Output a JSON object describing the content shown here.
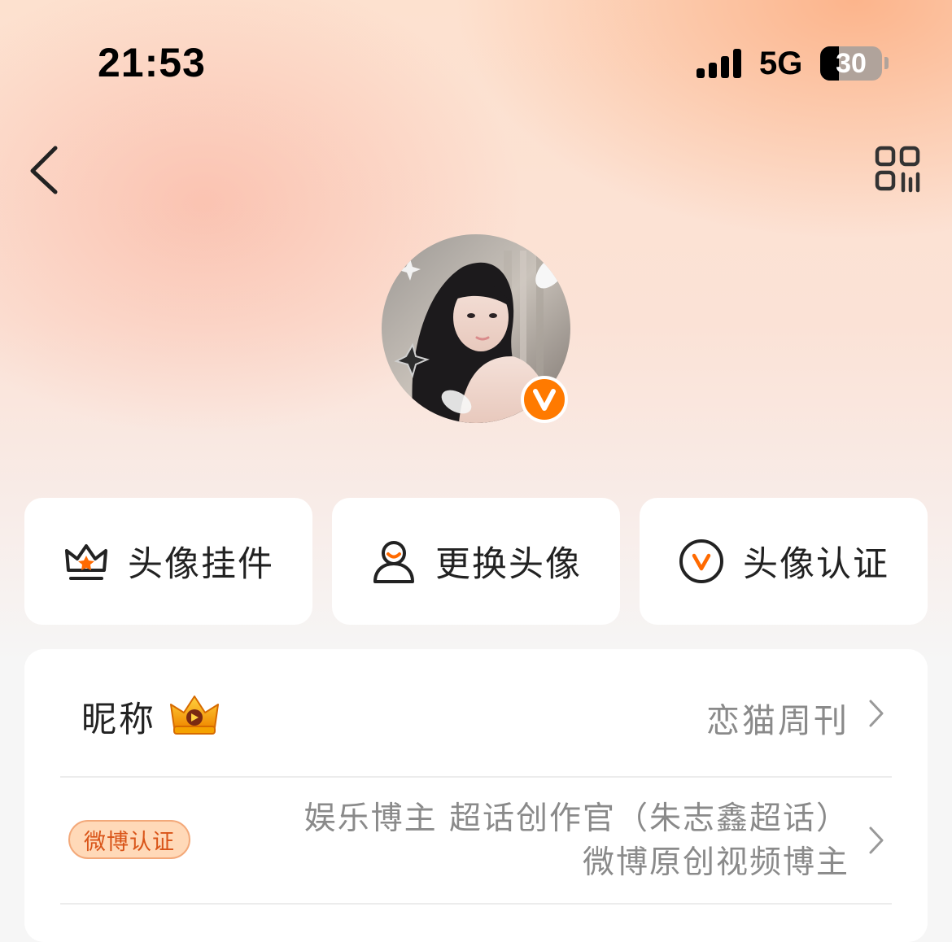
{
  "status_bar": {
    "time": "21:53",
    "network": "5G",
    "battery_level": "30",
    "battery_fraction": 0.3
  },
  "nav": {
    "back_icon": "chevron-left-icon",
    "qr_icon": "qr-code-icon"
  },
  "avatar": {
    "badge_icon": "verified-v-icon",
    "accent": "#ff7a00"
  },
  "actions": [
    {
      "label": "头像挂件",
      "icon": "crown-frame-icon"
    },
    {
      "label": "更换头像",
      "icon": "user-icon"
    },
    {
      "label": "头像认证",
      "icon": "verified-circle-icon"
    }
  ],
  "profile": {
    "nickname_label": "昵称",
    "nickname_value": "恋猫周刊",
    "certification_badge": "微博认证",
    "certification_lines": [
      "娱乐博主 超话创作官（朱志鑫超话）",
      "微博原创视频博主"
    ]
  }
}
